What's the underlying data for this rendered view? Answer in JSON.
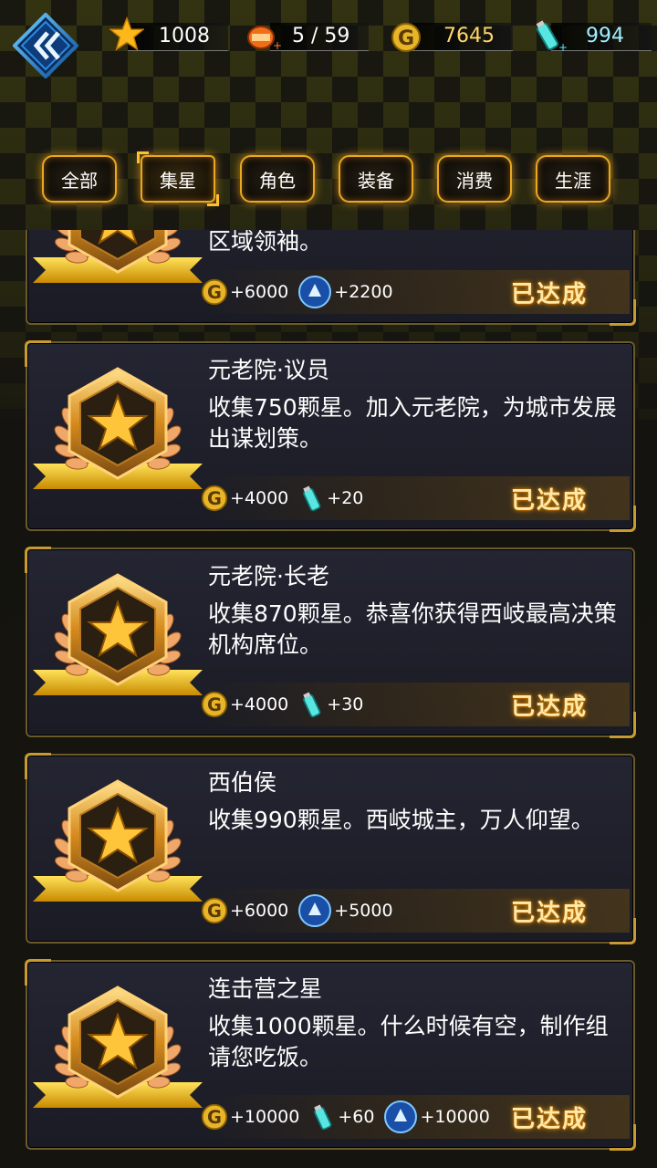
{
  "header": {
    "stars": "1008",
    "stamina": "5 / 59",
    "gold": "7645",
    "energy": "994"
  },
  "tabs": [
    {
      "label": "全部",
      "active": false
    },
    {
      "label": "集星",
      "active": true
    },
    {
      "label": "角色",
      "active": false
    },
    {
      "label": "装备",
      "active": false
    },
    {
      "label": "消费",
      "active": false
    },
    {
      "label": "生涯",
      "active": false
    }
  ],
  "achievements": [
    {
      "title": "",
      "desc": "区域领袖。",
      "rewards": [
        {
          "icon": "gold-coin-icon",
          "text": "+6000"
        },
        {
          "icon": "blue-badge-icon",
          "text": "+2200"
        }
      ],
      "status": "已达成"
    },
    {
      "title": "元老院·议员",
      "desc": "收集750颗星。加入元老院，为城市发展出谋划策。",
      "rewards": [
        {
          "icon": "gold-coin-icon",
          "text": "+4000"
        },
        {
          "icon": "energy-bottle-icon",
          "text": "+20"
        }
      ],
      "status": "已达成"
    },
    {
      "title": "元老院·长老",
      "desc": "收集870颗星。恭喜你获得西岐最高决策机构席位。",
      "rewards": [
        {
          "icon": "gold-coin-icon",
          "text": "+4000"
        },
        {
          "icon": "energy-bottle-icon",
          "text": "+30"
        }
      ],
      "status": "已达成"
    },
    {
      "title": "西伯侯",
      "desc": "收集990颗星。西岐城主，万人仰望。",
      "rewards": [
        {
          "icon": "gold-coin-icon",
          "text": "+6000"
        },
        {
          "icon": "blue-badge-icon",
          "text": "+5000"
        }
      ],
      "status": "已达成"
    },
    {
      "title": "连击营之星",
      "desc": "收集1000颗星。什么时候有空，制作组请您吃饭。",
      "rewards": [
        {
          "icon": "gold-coin-icon",
          "text": "+10000"
        },
        {
          "icon": "energy-bottle-icon",
          "text": "+60"
        },
        {
          "icon": "blue-badge-icon",
          "text": "+10000"
        }
      ],
      "status": "已达成"
    }
  ]
}
